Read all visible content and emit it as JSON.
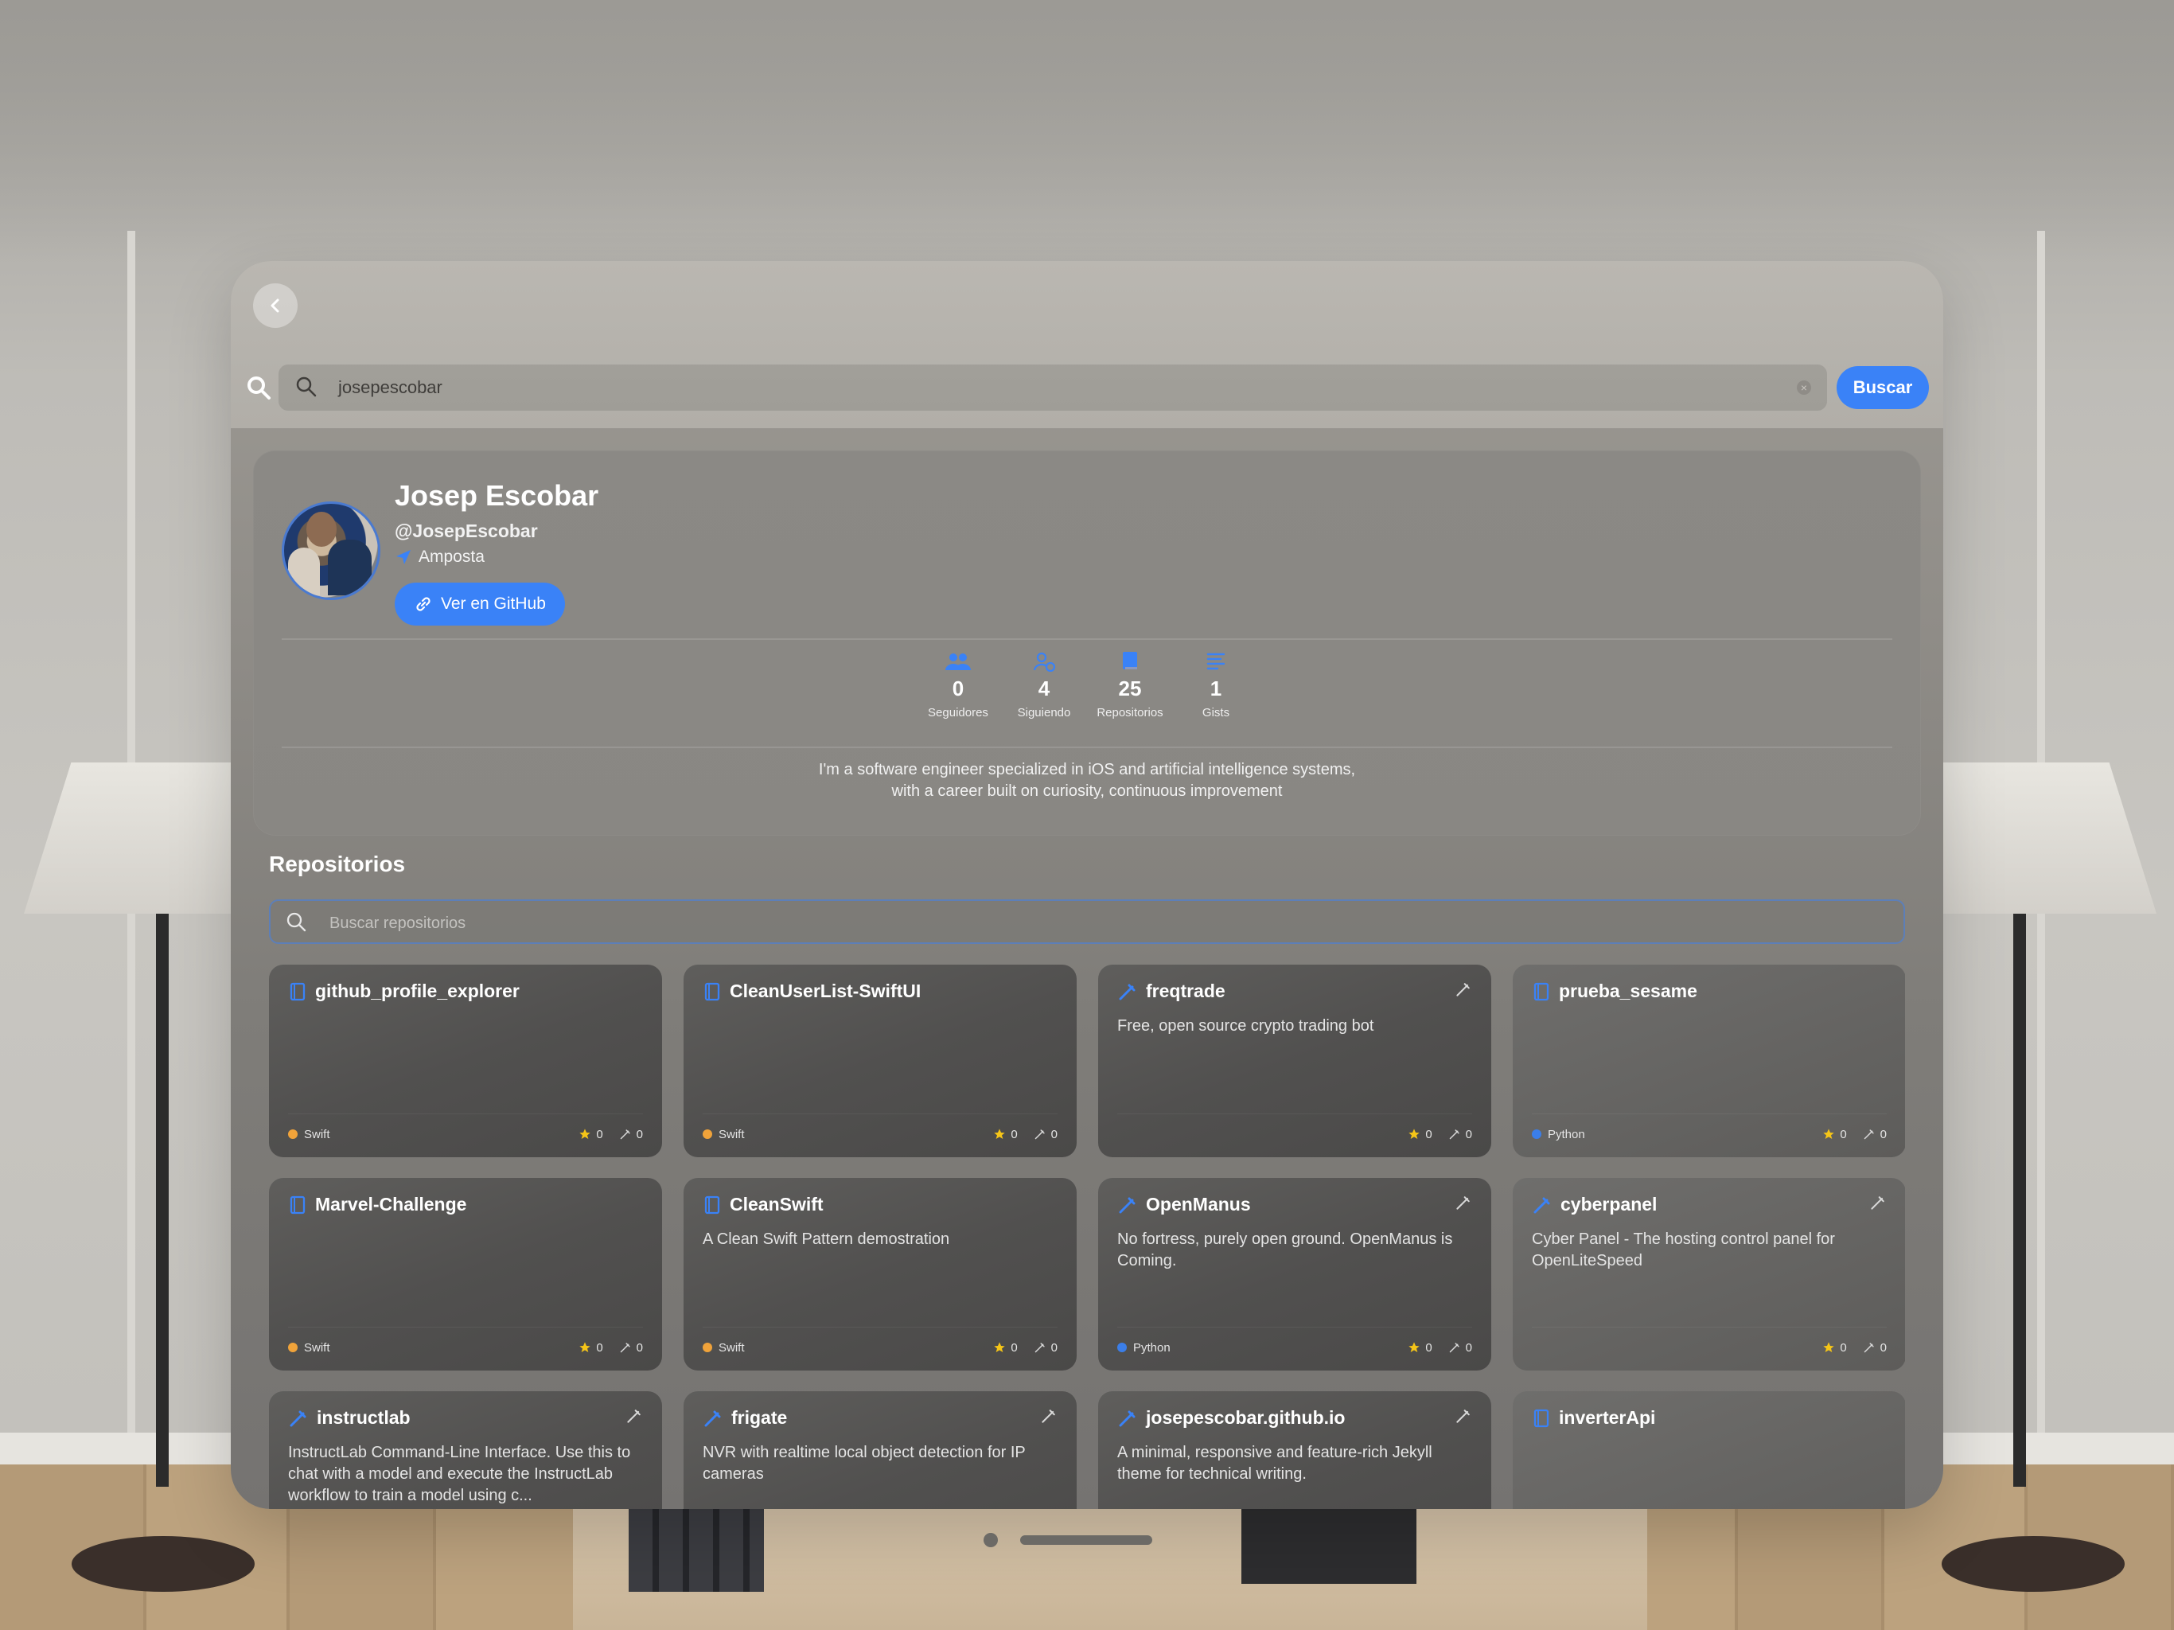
{
  "search": {
    "query": "josepescobar",
    "button_label": "Buscar"
  },
  "profile": {
    "name": "Josep Escobar",
    "handle": "@JosepEscobar",
    "location": "Amposta",
    "github_button": "Ver en GitHub",
    "stats": [
      {
        "value": "0",
        "label": "Seguidores",
        "icon": "people-icon"
      },
      {
        "value": "4",
        "label": "Siguiendo",
        "icon": "person-follow-icon"
      },
      {
        "value": "25",
        "label": "Repositorios",
        "icon": "book-icon"
      },
      {
        "value": "1",
        "label": "Gists",
        "icon": "lines-icon"
      }
    ],
    "bio_lines": [
      "I'm a software engineer specialized in iOS and artificial intelligence systems,",
      "with a career built on curiosity, continuous improvement"
    ]
  },
  "repos": {
    "title": "Repositorios",
    "search_placeholder": "Buscar repositorios",
    "items": [
      {
        "name": "github_profile_explorer",
        "desc": "",
        "lang": "Swift",
        "stars": "0",
        "forks": "0",
        "fork": false
      },
      {
        "name": "CleanUserList-SwiftUI",
        "desc": "",
        "lang": "Swift",
        "stars": "0",
        "forks": "0",
        "fork": false
      },
      {
        "name": "freqtrade",
        "desc": "Free, open source crypto trading bot",
        "lang": "",
        "stars": "0",
        "forks": "0",
        "fork": true
      },
      {
        "name": "prueba_sesame",
        "desc": "",
        "lang": "Python",
        "stars": "0",
        "forks": "0",
        "fork": false
      },
      {
        "name": "Marvel-Challenge",
        "desc": "",
        "lang": "Swift",
        "stars": "0",
        "forks": "0",
        "fork": false
      },
      {
        "name": "CleanSwift",
        "desc": "A Clean Swift Pattern demostration",
        "lang": "Swift",
        "stars": "0",
        "forks": "0",
        "fork": false
      },
      {
        "name": "OpenManus",
        "desc": "No fortress, purely open ground.  OpenManus is Coming.",
        "lang": "Python",
        "stars": "0",
        "forks": "0",
        "fork": true
      },
      {
        "name": "cyberpanel",
        "desc": "Cyber Panel - The hosting control panel for OpenLiteSpeed",
        "lang": "",
        "stars": "0",
        "forks": "0",
        "fork": true
      },
      {
        "name": "instructlab",
        "desc": "InstructLab Command-Line Interface.  Use this to chat with a model and execute the InstructLab workflow to train a model using c...",
        "lang": "",
        "stars": "",
        "forks": "",
        "fork": true
      },
      {
        "name": "frigate",
        "desc": "NVR with realtime local object detection for IP cameras",
        "lang": "",
        "stars": "",
        "forks": "",
        "fork": true
      },
      {
        "name": "josepescobar.github.io",
        "desc": "A minimal, responsive and feature-rich Jekyll theme for technical writing.",
        "lang": "",
        "stars": "",
        "forks": "",
        "fork": true
      },
      {
        "name": "inverterApi",
        "desc": "",
        "lang": "",
        "stars": "",
        "forks": "",
        "fork": false
      }
    ]
  },
  "colors": {
    "accent": "#3a82f7",
    "swift": "#f0a33a",
    "python": "#3b7ee8",
    "star": "#f5c518"
  }
}
